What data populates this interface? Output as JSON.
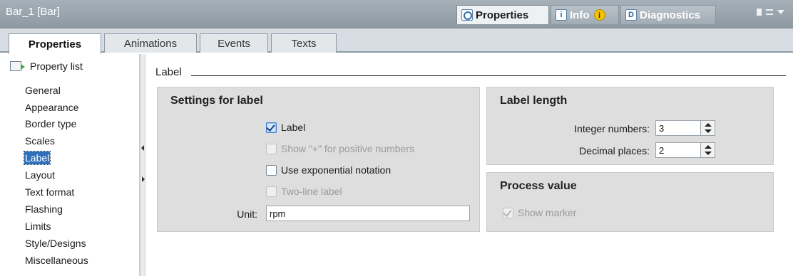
{
  "window": {
    "title": "Bar_1 [Bar]",
    "inspector_tabs": [
      {
        "label": "Properties",
        "icon": "properties-icon"
      },
      {
        "label": "Info",
        "icon": "info-icon",
        "badge": "i"
      },
      {
        "label": "Diagnostics",
        "icon": "diagnostics-icon"
      }
    ]
  },
  "subtabs": [
    "Properties",
    "Animations",
    "Events",
    "Texts"
  ],
  "nav": {
    "header": "Property list",
    "items": [
      "General",
      "Appearance",
      "Border type",
      "Scales",
      "Label",
      "Layout",
      "Text format",
      "Flashing",
      "Limits",
      "Style/Designs",
      "Miscellaneous"
    ],
    "selected": "Label"
  },
  "main": {
    "section_title": "Label",
    "settings": {
      "title": "Settings for label",
      "label_cb": {
        "text": "Label",
        "checked": true
      },
      "show_plus_cb": {
        "text": "Show \"+\" for positive numbers",
        "checked": false,
        "enabled": false
      },
      "exponential_cb": {
        "text": "Use exponential notation",
        "checked": false
      },
      "two_line_cb": {
        "text": "Two-line label",
        "checked": false,
        "enabled": false
      },
      "unit_label": "Unit:",
      "unit_value": "rpm"
    },
    "label_length": {
      "title": "Label length",
      "integer_label": "Integer numbers:",
      "integer_value": "3",
      "decimal_label": "Decimal places:",
      "decimal_value": "2"
    },
    "process_value": {
      "title": "Process value",
      "show_marker_cb": {
        "text": "Show marker",
        "checked": true,
        "enabled": false
      }
    }
  },
  "colors": {
    "selection": "#3170b8",
    "titlebar": "#9aa5ae",
    "group_bg": "#dedede"
  }
}
